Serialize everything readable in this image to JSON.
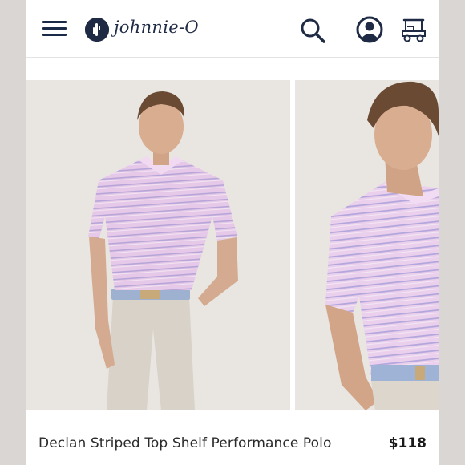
{
  "header": {
    "brand": "johnnie-O",
    "icons": [
      "hamburger-menu-icon",
      "brand-logo-icon",
      "search-icon",
      "account-icon",
      "golf-cart-icon"
    ]
  },
  "gallery": {
    "images": [
      {
        "description": "Model in pink striped polo, front view"
      },
      {
        "description": "Model in pink striped polo, side view"
      }
    ]
  },
  "product": {
    "title": "Declan Striped Top Shelf Performance Polo",
    "price": "$118"
  },
  "colors": {
    "brand_navy": "#1f2a44",
    "shirt_pink": "#e3c5e6",
    "stripe": "#a9b3da",
    "background": "#e7e3df"
  }
}
